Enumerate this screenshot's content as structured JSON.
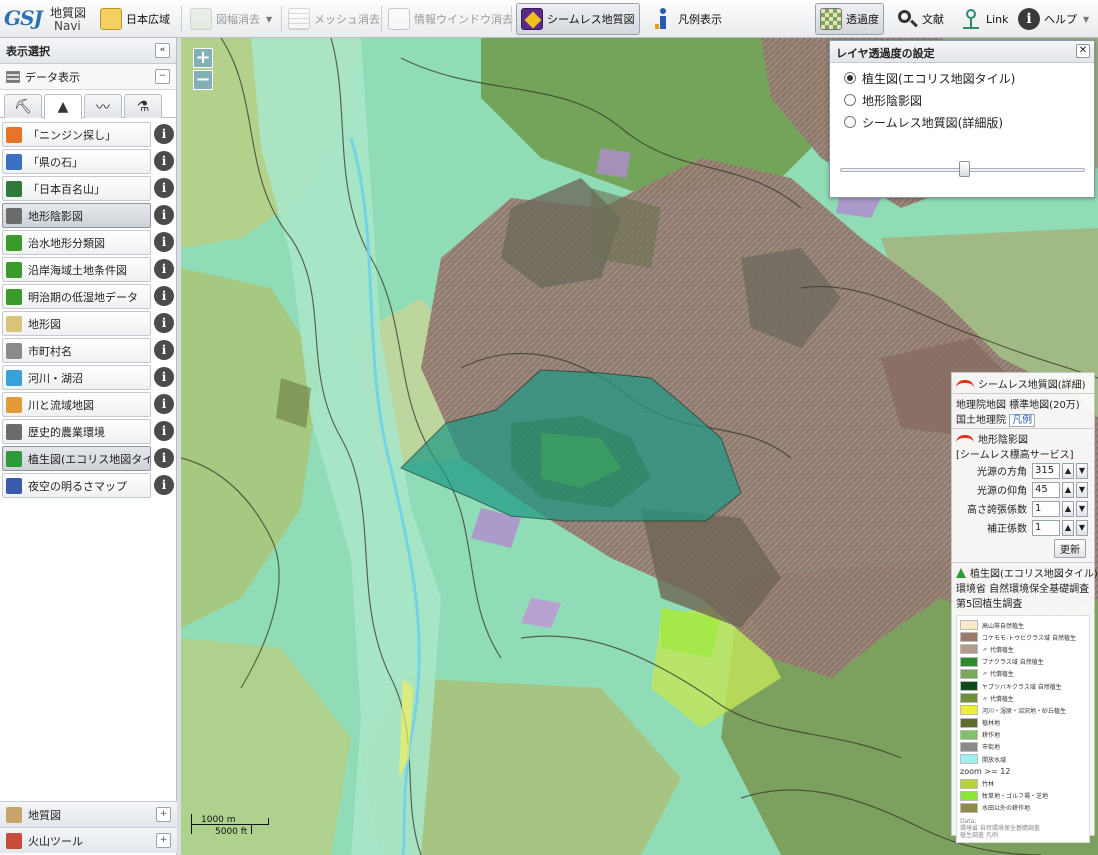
{
  "toolbar": {
    "logo_text1": "地質図",
    "logo_text2": "Navi",
    "logo_mark": "GSJ",
    "items": [
      {
        "label": "日本広域",
        "icon": "japan-map-icon"
      },
      {
        "label": "図幅消去",
        "icon": "erase-sheet-icon"
      },
      {
        "label": "メッシュ消去",
        "icon": "mesh-erase-icon"
      },
      {
        "label": "情報ウインドウ消去",
        "icon": "info-window-erase-icon"
      },
      {
        "label": "シームレス地質図",
        "icon": "seamless-geology-icon"
      },
      {
        "label": "凡例表示",
        "icon": "legend-icon"
      },
      {
        "label": "透過度",
        "icon": "transparency-icon"
      },
      {
        "label": "文献",
        "icon": "literature-search-icon"
      },
      {
        "label": "Link",
        "icon": "link-icon"
      },
      {
        "label": "ヘルプ",
        "icon": "help-icon"
      }
    ]
  },
  "sidebar": {
    "title": "表示選択",
    "collapse_glyph": "«",
    "data_display_label": "データ表示",
    "layers": [
      {
        "label": "「ニンジン探し」",
        "color": "#e8742a"
      },
      {
        "label": "「県の石」",
        "color": "#3a6fc4"
      },
      {
        "label": "「日本百名山」",
        "color": "#2f7a3a"
      },
      {
        "label": "地形陰影図",
        "color": "#6b6b6b"
      },
      {
        "label": "治水地形分類図",
        "color": "#3a9a2a"
      },
      {
        "label": "沿岸海域土地条件図",
        "color": "#3a9a2a"
      },
      {
        "label": "明治期の低湿地データ",
        "color": "#3a9a2a"
      },
      {
        "label": "地形図",
        "color": "#d9c27a"
      },
      {
        "label": "市町村名",
        "color": "#8a8a8a"
      },
      {
        "label": "河川・湖沼",
        "color": "#3aa0d8"
      },
      {
        "label": "川と流域地図",
        "color": "#e09a3a"
      },
      {
        "label": "歴史的農業環境",
        "color": "#6b6b6b"
      },
      {
        "label": "植生図(エコリス地図タイル)",
        "color": "#2f9a3a"
      },
      {
        "label": "夜空の明るさマップ",
        "color": "#3a5ab0"
      }
    ],
    "footer": [
      {
        "label": "地質図",
        "color": "#c9a46a"
      },
      {
        "label": "火山ツール",
        "color": "#c84a3a"
      }
    ]
  },
  "map": {
    "zoom_in": "+",
    "zoom_out": "−",
    "scale_m": "1000 m",
    "scale_ft": "5000 ft"
  },
  "transparency_panel": {
    "title": "レイヤ透過度の設定",
    "options": [
      "植生図(エコリス地図タイル)",
      "地形陰影図",
      "シームレス地質図(詳細版)"
    ],
    "selected_index": 0,
    "opacity": 0.5
  },
  "info_panel": {
    "seamless_title": "シームレス地質図(詳細)",
    "base_map_line": "地理院地図 標準地図(20万)",
    "gsi_label": "国土地理院",
    "legend_link": "凡例",
    "hillshade_title": "地形陰影図",
    "hillshade_sub": "[シームレス標高サービス]",
    "params": [
      {
        "label": "光源の方角",
        "value": "315"
      },
      {
        "label": "光源の仰角",
        "value": "45"
      },
      {
        "label": "高さ誇張係数",
        "value": "1"
      },
      {
        "label": "補正係数",
        "value": "1"
      }
    ],
    "update_label": "更新",
    "veg_title": "植生図(エコリス地図タイル)",
    "veg_line1": "環境省 自然環境保全基礎調査",
    "veg_line2": "第5回植生調査",
    "legend": [
      {
        "label": "高山帯自然植生",
        "color": "#fbe9c6"
      },
      {
        "label": "コケモモ-トウヒクラス域 自然植生",
        "color": "#9a7a66"
      },
      {
        "label": "〃 代償植生",
        "color": "#b39a8c"
      },
      {
        "label": "ブナクラス域 自然植生",
        "color": "#2e8a2e"
      },
      {
        "label": "〃 代償植生",
        "color": "#7aa85a"
      },
      {
        "label": "ヤブツバキクラス域 自然植生",
        "color": "#0f4a1c"
      },
      {
        "label": "〃 代償植生",
        "color": "#6f8f3a"
      },
      {
        "label": "河川・湿原・沼沢地・砂丘植生",
        "color": "#f0f02a"
      },
      {
        "label": "植林地",
        "color": "#5c6e2a"
      },
      {
        "label": "耕作地",
        "color": "#7fc26a"
      },
      {
        "label": "市街地",
        "color": "#8a8a8a"
      },
      {
        "label": "開放水域",
        "color": "#9ef0f0"
      },
      {
        "label": "zoom >= 12",
        "color": ""
      },
      {
        "label": "竹林",
        "color": "#b6d23a"
      },
      {
        "label": "牧草地・ゴルフ場・芝地",
        "color": "#8ee63a"
      },
      {
        "label": "水田以外の耕作地",
        "color": "#8e8a4a"
      }
    ],
    "legend_note1": "Data:",
    "legend_note2": "環境省 自然環境保全基礎調査",
    "legend_note3": "植生調査 凡例"
  },
  "colors": {
    "map_base": "#8fdcb6",
    "geology_brown": "#9c7f73",
    "hillshade_dark": "#6a6a5a",
    "forest_green": "#6f9a4a",
    "teal_overlay": "#2fa58a"
  }
}
